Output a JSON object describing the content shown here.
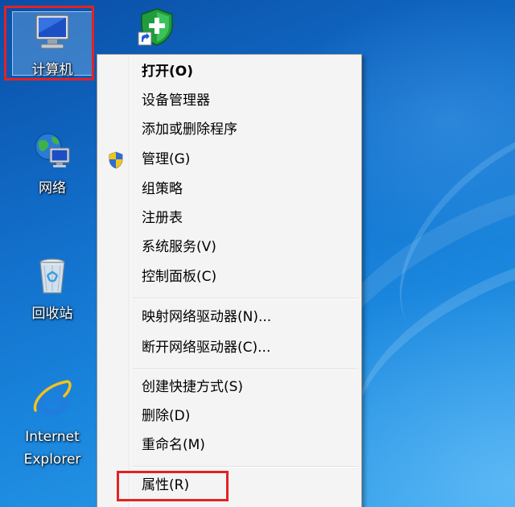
{
  "desktop": {
    "icons": [
      {
        "label": "计算机",
        "icon": "computer-icon"
      },
      {
        "label": "",
        "icon": "security-shield-shortcut-icon"
      },
      {
        "label": "网络",
        "icon": "network-globe-icon"
      },
      {
        "label": "回收站",
        "icon": "recycle-bin-icon"
      },
      {
        "label_line1": "Internet",
        "label_line2": "Explorer",
        "icon": "internet-explorer-icon"
      }
    ]
  },
  "context_menu": {
    "items": [
      {
        "label": "打开(O)",
        "bold": true
      },
      {
        "label": "设备管理器"
      },
      {
        "label": "添加或删除程序"
      },
      {
        "label": "管理(G)",
        "icon": "uac-shield-icon"
      },
      {
        "label": "组策略"
      },
      {
        "label": "注册表"
      },
      {
        "label": "系统服务(V)"
      },
      {
        "label": "控制面板(C)"
      },
      {
        "label": "映射网络驱动器(N)..."
      },
      {
        "label": "断开网络驱动器(C)..."
      },
      {
        "label": "创建快捷方式(S)"
      },
      {
        "label": "删除(D)"
      },
      {
        "label": "重命名(M)"
      },
      {
        "label": "属性(R)"
      }
    ]
  },
  "colors": {
    "highlight_box": "#e32224",
    "menu_background": "#f4f4f4",
    "desktop_blue": "#1270cb"
  }
}
